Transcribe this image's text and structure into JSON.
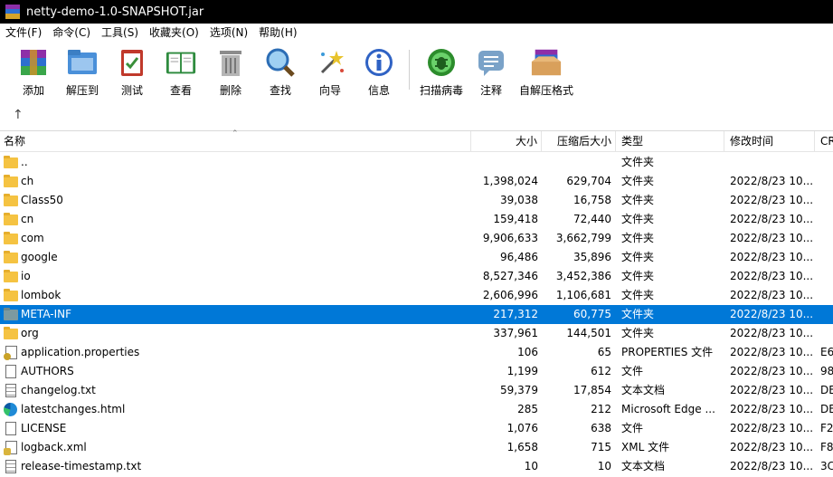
{
  "window": {
    "title": "netty-demo-1.0-SNAPSHOT.jar"
  },
  "menu": [
    "文件(F)",
    "命令(C)",
    "工具(S)",
    "收藏夹(O)",
    "选项(N)",
    "帮助(H)"
  ],
  "toolbar": [
    {
      "label": "添加",
      "icon": "add-archive-icon"
    },
    {
      "label": "解压到",
      "icon": "extract-to-icon"
    },
    {
      "label": "测试",
      "icon": "test-icon"
    },
    {
      "label": "查看",
      "icon": "view-book-icon"
    },
    {
      "label": "删除",
      "icon": "delete-trash-icon"
    },
    {
      "label": "查找",
      "icon": "find-magnifier-icon"
    },
    {
      "label": "向导",
      "icon": "wizard-wand-icon"
    },
    {
      "label": "信息",
      "icon": "info-icon"
    },
    {
      "label": "扫描病毒",
      "icon": "virus-scan-icon"
    },
    {
      "label": "注释",
      "icon": "comment-icon"
    },
    {
      "label": "自解压格式",
      "icon": "sfx-box-icon"
    }
  ],
  "nav": {
    "up_glyph": "↑"
  },
  "columns": {
    "name": "名称",
    "size": "大小",
    "packed": "压缩后大小",
    "type": "类型",
    "modified": "修改时间",
    "crc": "CR"
  },
  "files": [
    {
      "name": "..",
      "size": "",
      "packed": "",
      "type": "文件夹",
      "modified": "",
      "crc": "",
      "icon": "folder"
    },
    {
      "name": "ch",
      "size": "1,398,024",
      "packed": "629,704",
      "type": "文件夹",
      "modified": "2022/8/23 10...",
      "crc": "",
      "icon": "folder"
    },
    {
      "name": "Class50",
      "size": "39,038",
      "packed": "16,758",
      "type": "文件夹",
      "modified": "2022/8/23 10...",
      "crc": "",
      "icon": "folder"
    },
    {
      "name": "cn",
      "size": "159,418",
      "packed": "72,440",
      "type": "文件夹",
      "modified": "2022/8/23 10...",
      "crc": "",
      "icon": "folder"
    },
    {
      "name": "com",
      "size": "9,906,633",
      "packed": "3,662,799",
      "type": "文件夹",
      "modified": "2022/8/23 10...",
      "crc": "",
      "icon": "folder"
    },
    {
      "name": "google",
      "size": "96,486",
      "packed": "35,896",
      "type": "文件夹",
      "modified": "2022/8/23 10...",
      "crc": "",
      "icon": "folder"
    },
    {
      "name": "io",
      "size": "8,527,346",
      "packed": "3,452,386",
      "type": "文件夹",
      "modified": "2022/8/23 10...",
      "crc": "",
      "icon": "folder"
    },
    {
      "name": "lombok",
      "size": "2,606,996",
      "packed": "1,106,681",
      "type": "文件夹",
      "modified": "2022/8/23 10...",
      "crc": "",
      "icon": "folder"
    },
    {
      "name": "META-INF",
      "size": "217,312",
      "packed": "60,775",
      "type": "文件夹",
      "modified": "2022/8/23 10...",
      "crc": "",
      "icon": "folder-gray",
      "selected": true
    },
    {
      "name": "org",
      "size": "337,961",
      "packed": "144,501",
      "type": "文件夹",
      "modified": "2022/8/23 10...",
      "crc": "",
      "icon": "folder"
    },
    {
      "name": "application.properties",
      "size": "106",
      "packed": "65",
      "type": "PROPERTIES 文件",
      "modified": "2022/8/23 10...",
      "crc": "E6",
      "icon": "gear-doc"
    },
    {
      "name": "AUTHORS",
      "size": "1,199",
      "packed": "612",
      "type": "文件",
      "modified": "2022/8/23 10...",
      "crc": "98",
      "icon": "doc"
    },
    {
      "name": "changelog.txt",
      "size": "59,379",
      "packed": "17,854",
      "type": "文本文档",
      "modified": "2022/8/23 10...",
      "crc": "DE",
      "icon": "doc-lines"
    },
    {
      "name": "latestchanges.html",
      "size": "285",
      "packed": "212",
      "type": "Microsoft Edge ...",
      "modified": "2022/8/23 10...",
      "crc": "DE",
      "icon": "edge"
    },
    {
      "name": "LICENSE",
      "size": "1,076",
      "packed": "638",
      "type": "文件",
      "modified": "2022/8/23 10...",
      "crc": "F2",
      "icon": "doc"
    },
    {
      "name": "logback.xml",
      "size": "1,658",
      "packed": "715",
      "type": "XML 文件",
      "modified": "2022/8/23 10...",
      "crc": "F8",
      "icon": "xml-doc"
    },
    {
      "name": "release-timestamp.txt",
      "size": "10",
      "packed": "10",
      "type": "文本文档",
      "modified": "2022/8/23 10...",
      "crc": "3C",
      "icon": "doc-lines"
    }
  ],
  "colors": {
    "selection": "#0078d7",
    "titlebar": "#000000"
  }
}
